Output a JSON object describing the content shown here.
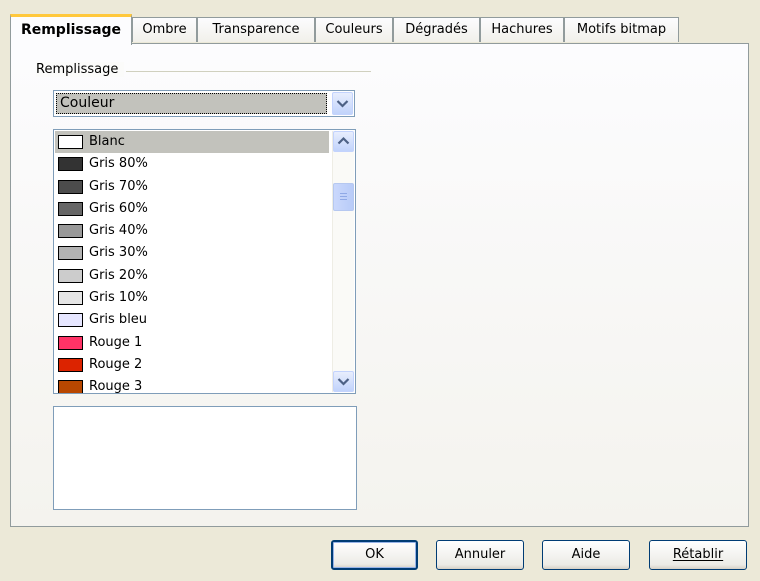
{
  "tabs": [
    {
      "label": "Remplissage",
      "active": true
    },
    {
      "label": "Ombre",
      "active": false
    },
    {
      "label": "Transparence",
      "active": false
    },
    {
      "label": "Couleurs",
      "active": false
    },
    {
      "label": "Dégradés",
      "active": false
    },
    {
      "label": "Hachures",
      "active": false
    },
    {
      "label": "Motifs bitmap",
      "active": false
    }
  ],
  "fill": {
    "group_label": "Remplissage",
    "type_select": {
      "value": "Couleur"
    },
    "color_list": {
      "selected": "Blanc",
      "items": [
        {
          "label": "Blanc",
          "color": "#ffffff"
        },
        {
          "label": "Gris 80%",
          "color": "#333333"
        },
        {
          "label": "Gris 70%",
          "color": "#4c4c4c"
        },
        {
          "label": "Gris 60%",
          "color": "#666666"
        },
        {
          "label": "Gris 40%",
          "color": "#999999"
        },
        {
          "label": "Gris 30%",
          "color": "#b2b2b2"
        },
        {
          "label": "Gris 20%",
          "color": "#cccccc"
        },
        {
          "label": "Gris 10%",
          "color": "#e5e5e5"
        },
        {
          "label": "Gris bleu",
          "color": "#e6e6ff"
        },
        {
          "label": "Rouge 1",
          "color": "#ff3366"
        },
        {
          "label": "Rouge 2",
          "color": "#dc2300"
        },
        {
          "label": "Rouge 3",
          "color": "#b84700"
        }
      ]
    }
  },
  "buttons": {
    "ok": "OK",
    "cancel": "Annuler",
    "help": "Aide",
    "reset": "Rétablir"
  },
  "icons": {
    "dropdown": "chevron-down-icon",
    "scroll_up": "chevron-up-icon",
    "scroll_down": "chevron-down-icon",
    "cursor": "mouse-pointer-icon"
  }
}
